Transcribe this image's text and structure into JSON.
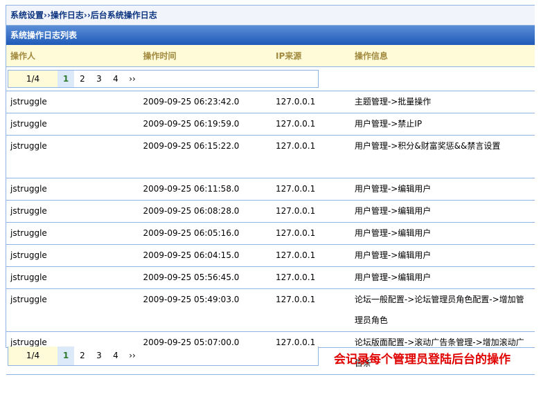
{
  "breadcrumb": "系统设置››操作日志››后台系统操作日志",
  "panel_title": "系统操作日志列表",
  "columns": [
    "操作人",
    "操作时间",
    "IP来源",
    "操作信息"
  ],
  "pager": {
    "count": "1/4",
    "pages": [
      "1",
      "2",
      "3",
      "4"
    ],
    "next": "››",
    "current": "1"
  },
  "rows": [
    {
      "user": "jstruggle",
      "time": "2009-09-25 06:23:42.0",
      "ip": "127.0.0.1",
      "msg": "主题管理->批量操作"
    },
    {
      "user": "jstruggle",
      "time": "2009-09-25 06:19:59.0",
      "ip": "127.0.0.1",
      "msg": "用户管理->禁止IP"
    },
    {
      "user": "jstruggle",
      "time": "2009-09-25 06:15:22.0",
      "ip": "127.0.0.1",
      "msg": "用户管理->积分&财富奖惩&&禁言设置"
    },
    {
      "user": "jstruggle",
      "time": "2009-09-25 06:11:58.0",
      "ip": "127.0.0.1",
      "msg": "用户管理->编辑用户"
    },
    {
      "user": "jstruggle",
      "time": "2009-09-25 06:08:28.0",
      "ip": "127.0.0.1",
      "msg": "用户管理->编辑用户"
    },
    {
      "user": "jstruggle",
      "time": "2009-09-25 06:05:16.0",
      "ip": "127.0.0.1",
      "msg": "用户管理->编辑用户"
    },
    {
      "user": "jstruggle",
      "time": "2009-09-25 06:04:15.0",
      "ip": "127.0.0.1",
      "msg": "用户管理->编辑用户"
    },
    {
      "user": "jstruggle",
      "time": "2009-09-25 05:56:45.0",
      "ip": "127.0.0.1",
      "msg": "用户管理->编辑用户"
    },
    {
      "user": "jstruggle",
      "time": "2009-09-25 05:49:03.0",
      "ip": "127.0.0.1",
      "msg": "论坛一般配置->论坛管理员角色配置->增加管理员角色"
    },
    {
      "user": "jstruggle",
      "time": "2009-09-25 05:07:00.0",
      "ip": "127.0.0.1",
      "msg": "论坛版面配置->滚动广告条管理->增加滚动广告条"
    }
  ],
  "annotation": "会记录每个管理员登陆后台的操作"
}
